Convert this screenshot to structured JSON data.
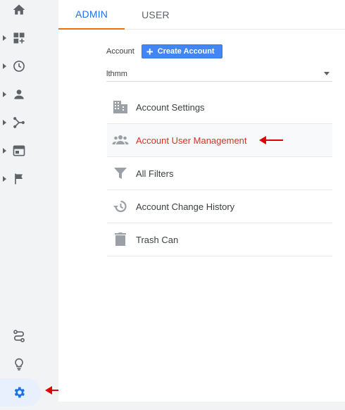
{
  "tabs": [
    {
      "label": "ADMIN",
      "active": true
    },
    {
      "label": "USER",
      "active": false
    }
  ],
  "account": {
    "label": "Account",
    "create_button": "Create Account",
    "selected": "lthmm"
  },
  "menu": [
    {
      "label": "Account Settings",
      "icon": "building-icon"
    },
    {
      "label": "Account User Management",
      "icon": "people-icon",
      "highlighted": true
    },
    {
      "label": "All Filters",
      "icon": "filter-icon"
    },
    {
      "label": "Account Change History",
      "icon": "history-icon"
    },
    {
      "label": "Trash Can",
      "icon": "trash-icon"
    }
  ],
  "rail": {
    "items": [
      "home-icon",
      "dashboards-icon",
      "realtime-icon",
      "audience-icon",
      "acquisition-icon",
      "behavior-icon",
      "conversions-icon"
    ],
    "bottom": [
      "attribution-icon",
      "discover-icon",
      "admin-gear-icon"
    ]
  },
  "colors": {
    "accent": "#1a73e8",
    "tab_underline": "#e8710a",
    "highlight_text": "#d93025",
    "annotation_arrow": "#e00000"
  }
}
